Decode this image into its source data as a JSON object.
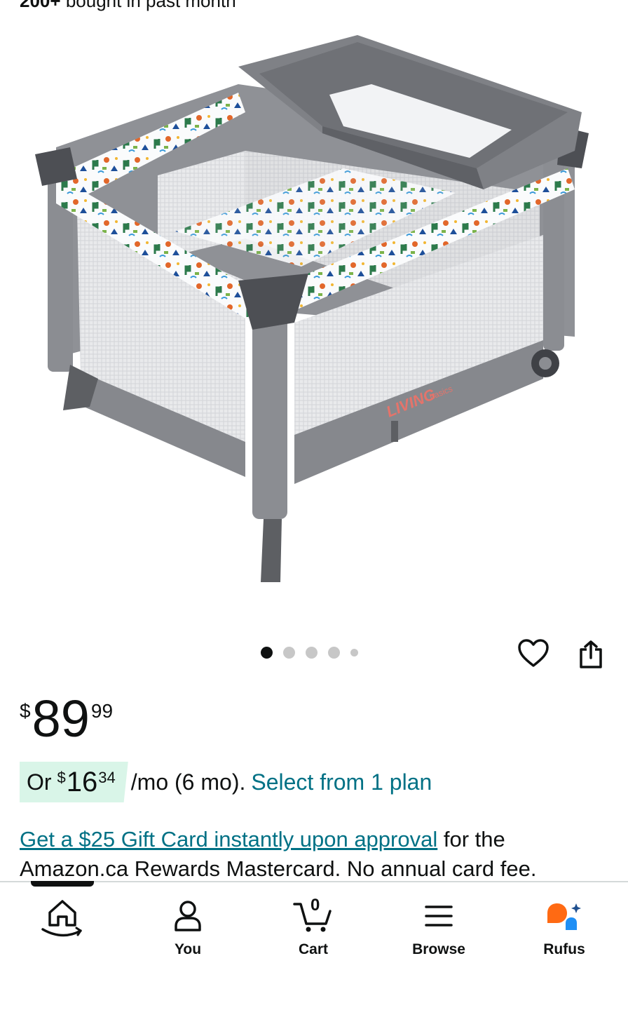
{
  "header": {
    "purchase_count": "200+",
    "purchase_suffix": "bought in past month"
  },
  "gallery": {
    "image_alt": "Living Basics portable playard crib with bassinet changer",
    "brand_mark": "LIVING",
    "brand_sub": "basics",
    "dots_total": 5,
    "dots_active": 1
  },
  "price": {
    "currency": "$",
    "whole": "89",
    "fraction": "99"
  },
  "installment": {
    "prefix": "Or",
    "currency": "$",
    "whole": "16",
    "fraction": "34",
    "suffix": "/mo (6 mo).",
    "link_label": "Select from 1 plan"
  },
  "promo": {
    "link_text": "Get a $25 Gift Card instantly upon approval",
    "text": "for the Amazon.ca Rewards Mastercard. No annual card fee."
  },
  "nav": {
    "items": [
      {
        "label": "",
        "icon": "home-icon"
      },
      {
        "label": "You",
        "icon": "user-icon"
      },
      {
        "label": "Cart",
        "icon": "cart-icon",
        "badge": "0"
      },
      {
        "label": "Browse",
        "icon": "menu-icon"
      },
      {
        "label": "Rufus",
        "icon": "rufus-icon"
      }
    ]
  },
  "colors": {
    "link": "#007185",
    "installment_bg": "#d9f5e8",
    "rufus_orange": "#ff6a13",
    "rufus_blue": "#1f8ff5"
  }
}
